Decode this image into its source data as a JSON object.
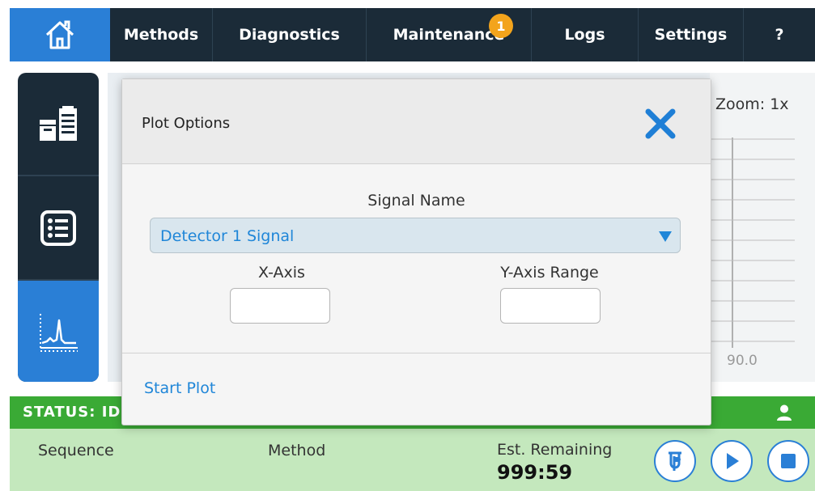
{
  "nav": {
    "items": [
      {
        "label": "Methods"
      },
      {
        "label": "Diagnostics"
      },
      {
        "label": "Maintenance"
      },
      {
        "label": "Logs"
      },
      {
        "label": "Settings"
      },
      {
        "label": "?"
      }
    ],
    "maintenance_badge": "1",
    "home_icon": "home-icon"
  },
  "rail": {
    "items": [
      {
        "icon": "instrument-modules-icon"
      },
      {
        "icon": "list-icon"
      },
      {
        "icon": "chromatogram-icon",
        "active": true
      }
    ]
  },
  "plot": {
    "zoom_label": "Zoom: 1x",
    "tick_label": "90.0"
  },
  "dialog": {
    "title": "Plot Options",
    "signal_label": "Signal Name",
    "signal_value": "Detector 1 Signal",
    "x_axis_label": "X-Axis",
    "x_axis_value": "",
    "y_axis_label": "Y-Axis Range",
    "y_axis_value": "",
    "start_label": "Start Plot"
  },
  "status": {
    "text": "STATUS: ID"
  },
  "bottom": {
    "sequence_label": "Sequence",
    "method_label": "Method",
    "remaining_label": "Est. Remaining",
    "remaining_value": "999:59"
  },
  "colors": {
    "nav_bg": "#1b2b38",
    "accent_blue": "#2a7fd6",
    "status_green": "#3aaa35",
    "bottom_green": "#c4e8bd",
    "badge_orange": "#f3a41c"
  }
}
